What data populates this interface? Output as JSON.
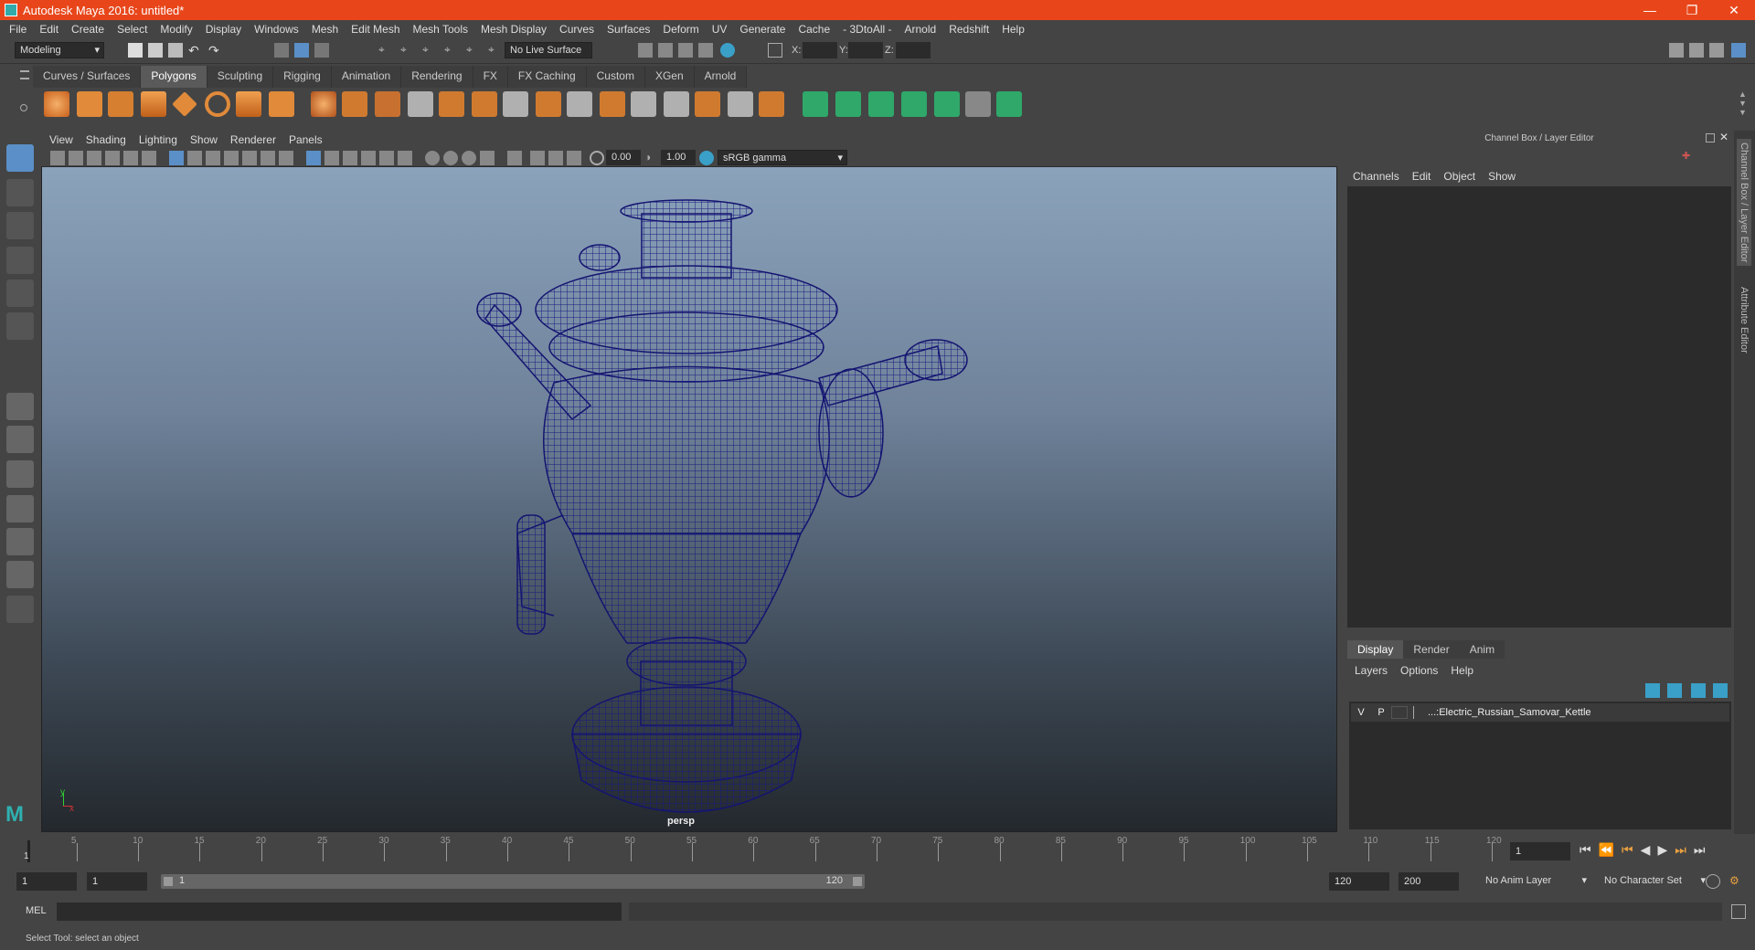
{
  "window": {
    "title": "Autodesk Maya 2016: untitled*"
  },
  "menubar": [
    "File",
    "Edit",
    "Create",
    "Select",
    "Modify",
    "Display",
    "Windows",
    "Mesh",
    "Edit Mesh",
    "Mesh Tools",
    "Mesh Display",
    "Curves",
    "Surfaces",
    "Deform",
    "UV",
    "Generate",
    "Cache",
    "- 3DtoAll -",
    "Arnold",
    "Redshift",
    "Help"
  ],
  "statusline": {
    "mode": "Modeling",
    "live_surface": "No Live Surface",
    "x_label": "X:",
    "y_label": "Y:",
    "z_label": "Z:"
  },
  "shelf_tabs": [
    "Curves / Surfaces",
    "Polygons",
    "Sculpting",
    "Rigging",
    "Animation",
    "Rendering",
    "FX",
    "FX Caching",
    "Custom",
    "XGen",
    "Arnold"
  ],
  "shelf_active": "Polygons",
  "viewport": {
    "menu": [
      "View",
      "Shading",
      "Lighting",
      "Show",
      "Renderer",
      "Panels"
    ],
    "exposure": "0.00",
    "gamma": "1.00",
    "colorspace": "sRGB gamma",
    "camera": "persp",
    "axis_y": "y",
    "axis_x": "x"
  },
  "channelbox": {
    "title": "Channel Box / Layer Editor",
    "menu": [
      "Channels",
      "Edit",
      "Object",
      "Show"
    ]
  },
  "layer_editor": {
    "tabs": [
      "Display",
      "Render",
      "Anim"
    ],
    "active_tab": "Display",
    "menu": [
      "Layers",
      "Options",
      "Help"
    ],
    "layers": [
      {
        "v": "V",
        "p": "P",
        "name": "...:Electric_Russian_Samovar_Kettle"
      }
    ]
  },
  "side_tabs": [
    "Channel Box / Layer Editor",
    "Attribute Editor"
  ],
  "timeline": {
    "ticks": [
      "5",
      "10",
      "15",
      "20",
      "25",
      "30",
      "35",
      "40",
      "45",
      "50",
      "55",
      "60",
      "65",
      "70",
      "75",
      "80",
      "85",
      "90",
      "95",
      "100",
      "105",
      "110",
      "115",
      "120"
    ],
    "first": "1",
    "current_frame": "1"
  },
  "range": {
    "start": "1",
    "start_inner": "1",
    "slider_start": "1",
    "slider_end": "120",
    "end_inner": "120",
    "end": "200",
    "anim_layer": "No Anim Layer",
    "char_set": "No Character Set"
  },
  "cmdline": {
    "label": "MEL"
  },
  "helpline": {
    "text": "Select Tool: select an object"
  },
  "colors": {
    "title_bar": "#e8461a",
    "wire": "#1a1a80",
    "viewport_top": "#8fa7c0",
    "viewport_bottom": "#23282d"
  }
}
